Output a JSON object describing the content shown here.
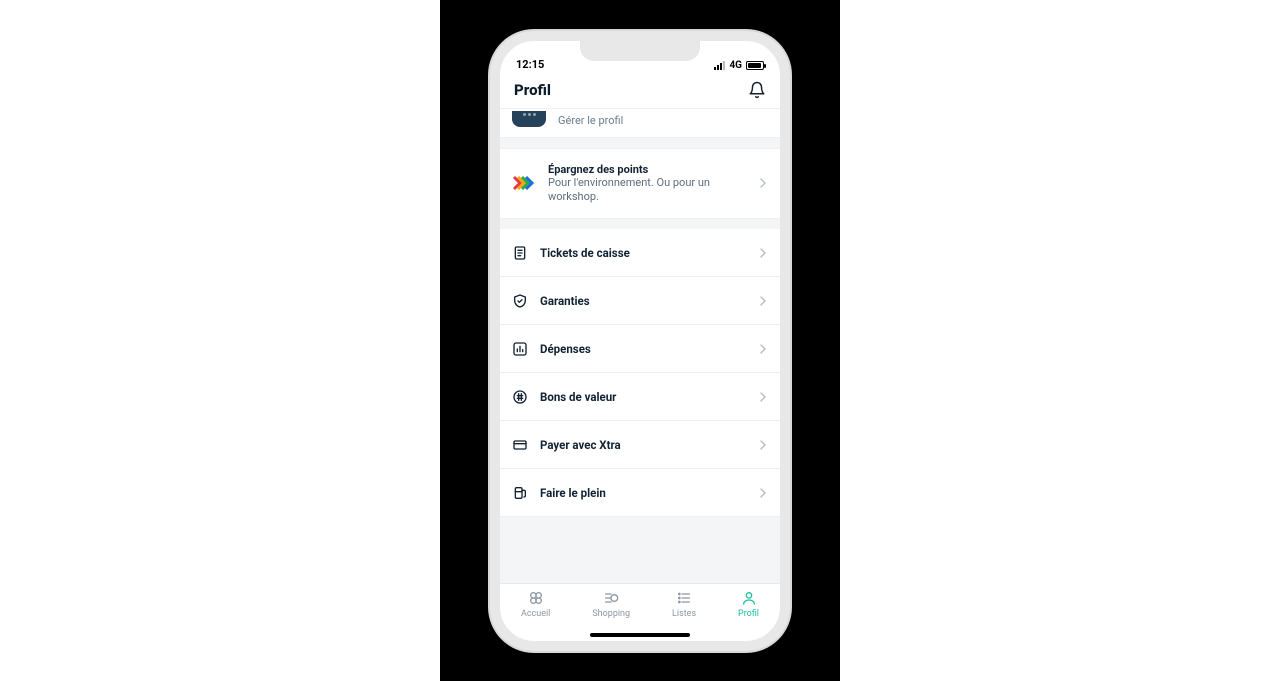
{
  "status_bar": {
    "time": "12:15",
    "network": "4G"
  },
  "header": {
    "title": "Profil",
    "icon": "bell-icon"
  },
  "profile": {
    "manage_label": "Gérer le profil"
  },
  "points": {
    "title": "Épargnez des points",
    "subtitle": "Pour l'environnement. Ou pour un workshop."
  },
  "menu": [
    {
      "icon": "receipt-icon",
      "label": "Tickets de caisse"
    },
    {
      "icon": "shield-icon",
      "label": "Garanties"
    },
    {
      "icon": "chart-icon",
      "label": "Dépenses"
    },
    {
      "icon": "voucher-icon",
      "label": "Bons de valeur"
    },
    {
      "icon": "card-icon",
      "label": "Payer avec Xtra"
    },
    {
      "icon": "fuel-icon",
      "label": "Faire le plein"
    }
  ],
  "tabs": [
    {
      "icon": "home-icon",
      "label": "Accueil",
      "active": false
    },
    {
      "icon": "shopping-icon",
      "label": "Shopping",
      "active": false
    },
    {
      "icon": "list-icon",
      "label": "Listes",
      "active": false
    },
    {
      "icon": "profile-icon",
      "label": "Profil",
      "active": true
    }
  ],
  "colors": {
    "accent": "#18bfa3",
    "text": "#122233",
    "muted": "#8b97a2"
  }
}
